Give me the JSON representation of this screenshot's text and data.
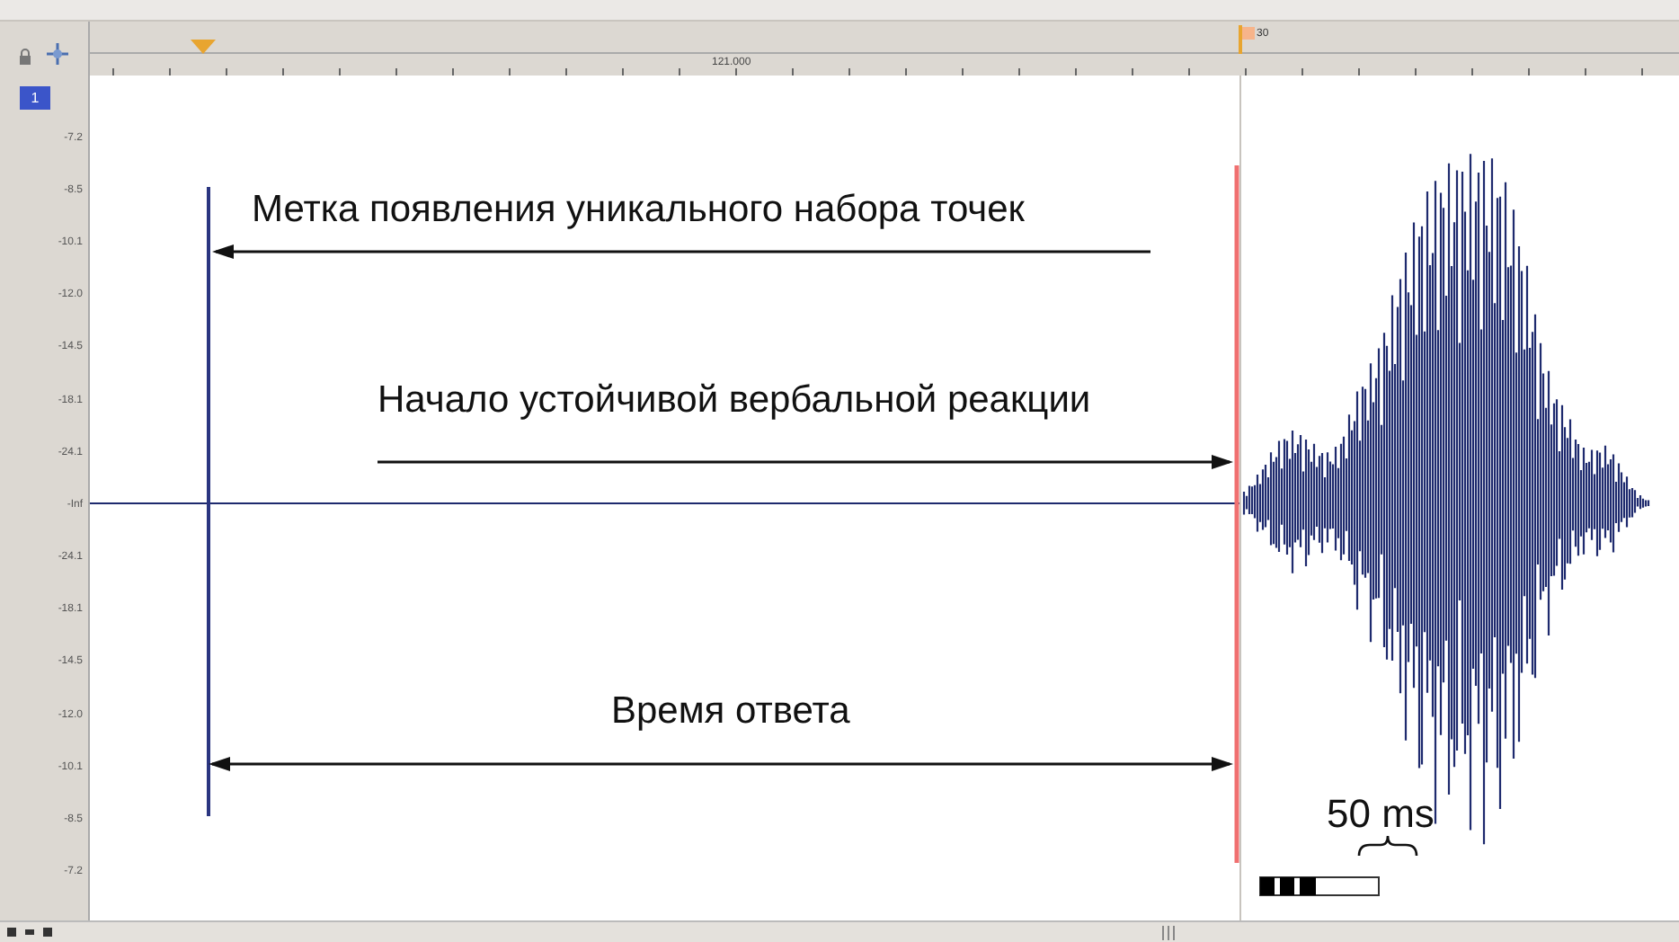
{
  "ruler": {
    "time_label": "121.000",
    "marker_label": "30"
  },
  "channel_badge": "1",
  "amplitude_axis": [
    "-7.2",
    "-8.5",
    "-10.1",
    "-12.0",
    "-14.5",
    "-18.1",
    "-24.1",
    "-Inf",
    "-24.1",
    "-18.1",
    "-14.5",
    "-12.0",
    "-10.1",
    "-8.5",
    "-7.2"
  ],
  "annotations": [
    {
      "kind": "arrow-left",
      "text": "Метка появления уникального набора точек"
    },
    {
      "kind": "arrow-right",
      "text": "Начало устойчивой вербальной реакции"
    },
    {
      "kind": "double-arrow",
      "text": "Время ответа"
    }
  ],
  "scale_bar": {
    "label": "50 ms"
  }
}
